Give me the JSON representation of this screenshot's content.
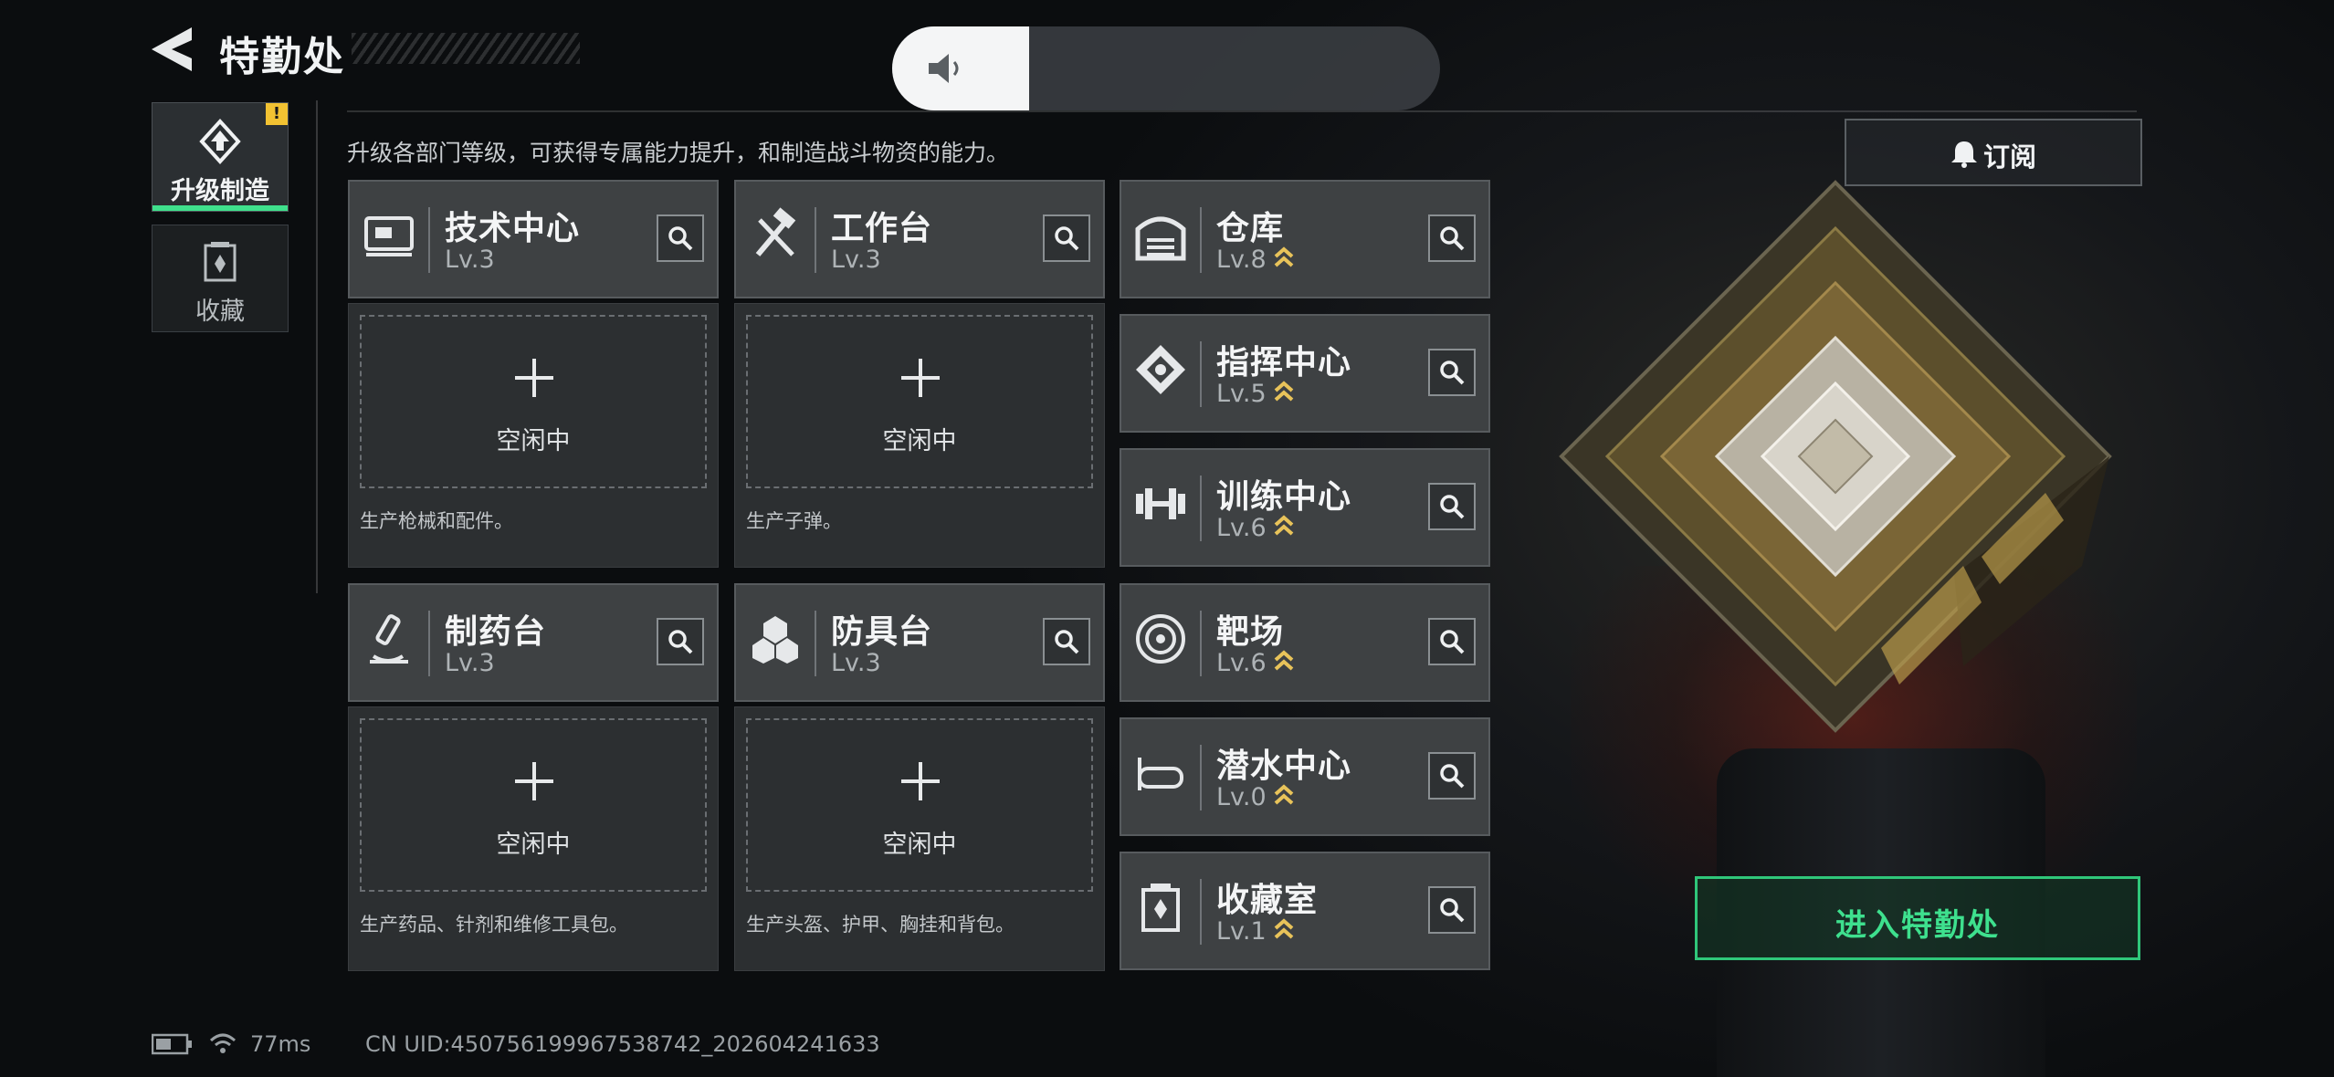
{
  "header": {
    "title": "特勤处"
  },
  "volume": {
    "level": 0.25
  },
  "sidebar": {
    "items": [
      {
        "label": "升级制造",
        "active": true,
        "badge": "!"
      },
      {
        "label": "收藏",
        "active": false
      }
    ]
  },
  "main": {
    "description": "升级各部门等级，可获得专属能力提升，和制造战斗物资的能力。",
    "subscribe_label": "订阅",
    "idle_label": "空闲中",
    "production": [
      {
        "name": "技术中心",
        "level": "Lv.3",
        "slot_desc": "生产枪械和配件。",
        "icon": "tech-center-icon"
      },
      {
        "name": "工作台",
        "level": "Lv.3",
        "slot_desc": "生产子弹。",
        "icon": "workbench-icon"
      },
      {
        "name": "制药台",
        "level": "Lv.3",
        "slot_desc": "生产药品、针剂和维修工具包。",
        "icon": "pharmacy-icon"
      },
      {
        "name": "防具台",
        "level": "Lv.3",
        "slot_desc": "生产头盔、护甲、胸挂和背包。",
        "icon": "armor-bench-icon"
      }
    ],
    "facilities": [
      {
        "name": "仓库",
        "level": "Lv.8",
        "icon": "warehouse-icon"
      },
      {
        "name": "指挥中心",
        "level": "Lv.5",
        "icon": "command-center-icon"
      },
      {
        "name": "训练中心",
        "level": "Lv.6",
        "icon": "training-center-icon"
      },
      {
        "name": "靶场",
        "level": "Lv.6",
        "icon": "shooting-range-icon"
      },
      {
        "name": "潜水中心",
        "level": "Lv.0",
        "icon": "diving-center-icon"
      },
      {
        "name": "收藏室",
        "level": "Lv.1",
        "icon": "collection-room-icon"
      }
    ],
    "enter_label": "进入特勤处"
  },
  "status_bar": {
    "ping": "77ms",
    "uid": "CN UID:450756199967538742_202604241633"
  },
  "colors": {
    "accent": "#3ee08e",
    "upgrade_chevron": "#e8c35a",
    "warning": "#f2c232"
  }
}
